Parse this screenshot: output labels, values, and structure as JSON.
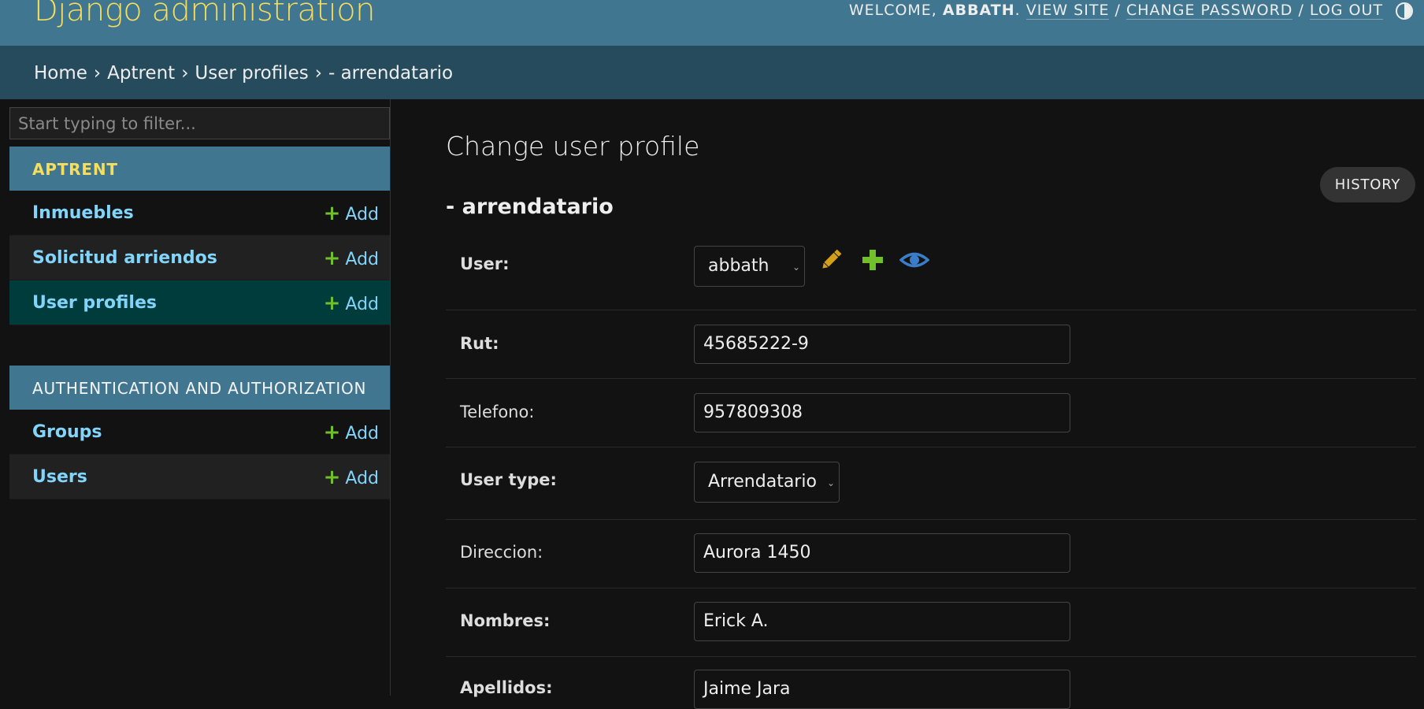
{
  "header": {
    "branding": "Django administration",
    "welcome": "WELCOME, ",
    "username": "ABBATH",
    "view_site": "VIEW SITE",
    "change_password": "CHANGE PASSWORD",
    "log_out": "LOG OUT",
    "sep1": ". ",
    "sep2": " / ",
    "sep3": " / "
  },
  "breadcrumbs": {
    "home": "Home",
    "app": "Aptrent",
    "model": "User profiles",
    "current": "- arrendatario",
    "separator": "›"
  },
  "sidebar": {
    "filter_placeholder": "Start typing to filter...",
    "modules": [
      {
        "caption": "APTRENT",
        "models": [
          {
            "label": "Inmuebles",
            "add": "Add"
          },
          {
            "label": "Solicitud arriendos",
            "add": "Add"
          },
          {
            "label": "User profiles",
            "add": "Add"
          }
        ]
      },
      {
        "caption": "AUTHENTICATION AND AUTHORIZATION",
        "models": [
          {
            "label": "Groups",
            "add": "Add"
          },
          {
            "label": "Users",
            "add": "Add"
          }
        ]
      }
    ]
  },
  "content": {
    "title": "Change user profile",
    "history": "HISTORY",
    "fieldset_title": "- arrendatario",
    "fields": {
      "user": {
        "label": "User:",
        "value": "abbath"
      },
      "rut": {
        "label": "Rut:",
        "value": "45685222-9"
      },
      "telefono": {
        "label": "Telefono:",
        "value": "957809308"
      },
      "user_type": {
        "label": "User type:",
        "value": "Arrendatario"
      },
      "direccion": {
        "label": "Direccion:",
        "value": "Aurora 1450"
      },
      "nombres": {
        "label": "Nombres:",
        "value": "Erick A."
      },
      "apellidos": {
        "label": "Apellidos:",
        "value": "Jaime Jara"
      }
    }
  },
  "colors": {
    "header_bg": "#417690",
    "breadcrumbs_bg": "#264b5d",
    "branding": "#f5dd5d",
    "link": "#81d4fa",
    "add_plus": "#70bf2b",
    "current_row": "#003c3c",
    "edit_icon": "#d4a017",
    "view_icon": "#3a7dc9"
  },
  "icons": {
    "edit": "pencil-icon",
    "add": "plus-icon",
    "view": "eye-icon",
    "theme": "half-circle-icon"
  }
}
